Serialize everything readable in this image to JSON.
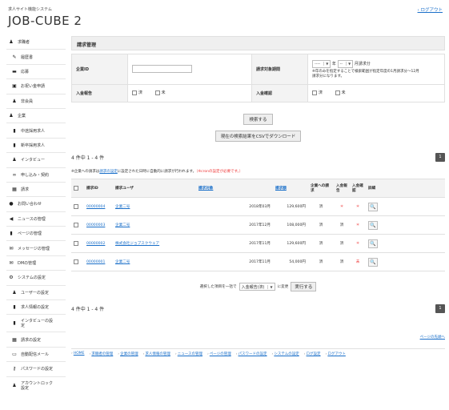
{
  "header": {
    "system_name": "求人サイト機能システム",
    "app_title": "JOB-CUBE 2",
    "logout_label": "› ログアウト"
  },
  "sidebar": {
    "items": [
      {
        "label": "求職者",
        "icon": "person-icon",
        "level": 1
      },
      {
        "label": "履歴書",
        "icon": "pen-icon",
        "level": 2
      },
      {
        "label": "応募",
        "icon": "briefcase-icon",
        "level": 2
      },
      {
        "label": "お祝い金申請",
        "icon": "gift-icon",
        "level": 2
      },
      {
        "label": "非会員",
        "icon": "person-icon",
        "level": 2
      },
      {
        "label": "企業",
        "icon": "people-icon",
        "level": 1
      },
      {
        "label": "中途採用求人",
        "icon": "document-icon",
        "level": 2
      },
      {
        "label": "新卒採用求人",
        "icon": "document-icon",
        "level": 2
      },
      {
        "label": "インタビュー",
        "icon": "people-icon",
        "level": 2
      },
      {
        "label": "申し込み・契約",
        "icon": "link-icon",
        "level": 2
      },
      {
        "label": "請求",
        "icon": "grid-icon",
        "level": 2
      },
      {
        "label": "お問い合わせ",
        "icon": "info-icon",
        "level": 1
      },
      {
        "label": "ニュースの管理",
        "icon": "megaphone-icon",
        "level": 1
      },
      {
        "label": "ページの管理",
        "icon": "document-icon",
        "level": 1
      },
      {
        "label": "メッセージの管理",
        "icon": "envelope-icon",
        "level": 1
      },
      {
        "label": "DMの管理",
        "icon": "envelope-icon",
        "level": 1
      },
      {
        "label": "システムの設定",
        "icon": "gears-icon",
        "level": 1
      },
      {
        "label": "ユーザーの設定",
        "icon": "people-icon",
        "level": 2
      },
      {
        "label": "求人情報の設定",
        "icon": "document-icon",
        "level": 2
      },
      {
        "label": "インタビューの設定",
        "icon": "document-icon",
        "level": 2
      },
      {
        "label": "請求の設定",
        "icon": "grid-icon",
        "level": 2
      },
      {
        "label": "自動配信メール",
        "icon": "monitor-icon",
        "level": 2
      },
      {
        "label": "パスワードの設定",
        "icon": "key-icon",
        "level": 2
      },
      {
        "label": "アカウントロック設定",
        "icon": "people-icon",
        "level": 2
      }
    ]
  },
  "main": {
    "title": "請求管理",
    "search": {
      "company_id_label": "企業ID",
      "company_id_value": "",
      "period_label": "請求対象期間",
      "year_select": "----",
      "year_unit": "年",
      "month_select": "--",
      "month_unit": "月請求分",
      "period_note": "※年のみを指定することで検索範囲が指定年度の1月請求分〜12月請求分になります。",
      "notify_label": "入金報告",
      "confirm_label": "入金確認",
      "opt_done": "済",
      "opt_not": "未"
    },
    "search_button": "検索する",
    "csv_button": "現在の検索結果をCSVでダウンロード",
    "count_top": "4 件中 1 - 4 件",
    "count_bottom": "4 件中 1 - 4 件",
    "page_number": "1",
    "note_prefix": "※企業への請求は",
    "note_link": "請求の設定",
    "note_middle": "に設定された日時に自動的に請求が行われます。",
    "note_red": "（※cronの設定が必要です。）",
    "table": {
      "headers": [
        "請求ID",
        "請求ユーザ",
        "請求対象",
        "請求額",
        "企業への請求",
        "入金報告",
        "入金確認",
        "詳細"
      ],
      "rows": [
        {
          "id": "00000004",
          "user": "企業二号",
          "target": "2018年03月",
          "amount": "129,600円",
          "billed": "済",
          "notify": "＊",
          "confirm": "＊"
        },
        {
          "id": "00000003",
          "user": "企業二号",
          "target": "2017年12月",
          "amount": "108,000円",
          "billed": "済",
          "notify": "済",
          "confirm": "＊"
        },
        {
          "id": "00000002",
          "user": "株式会社ジョブスクウェア",
          "target": "2017年11月",
          "amount": "129,600円",
          "billed": "済",
          "notify": "済",
          "confirm": "＊"
        },
        {
          "id": "00000001",
          "user": "企業二号",
          "target": "2017年11月",
          "amount": "54,000円",
          "billed": "済",
          "notify": "済",
          "confirm": "未"
        }
      ]
    },
    "bulk": {
      "prefix": "選択した項目を一括で",
      "select_value": "入金報告(済)",
      "suffix": "に変更",
      "execute_button": "実行する"
    },
    "top_link": "ページの先頭へ"
  },
  "footer": {
    "links": [
      "HOME",
      "求職者の管理",
      "企業の管理",
      "求人情報の管理",
      "ニュースの管理",
      "ページの管理",
      "パスワードの設定",
      "システムの設定",
      "ログ設定",
      "ログアウト"
    ]
  }
}
